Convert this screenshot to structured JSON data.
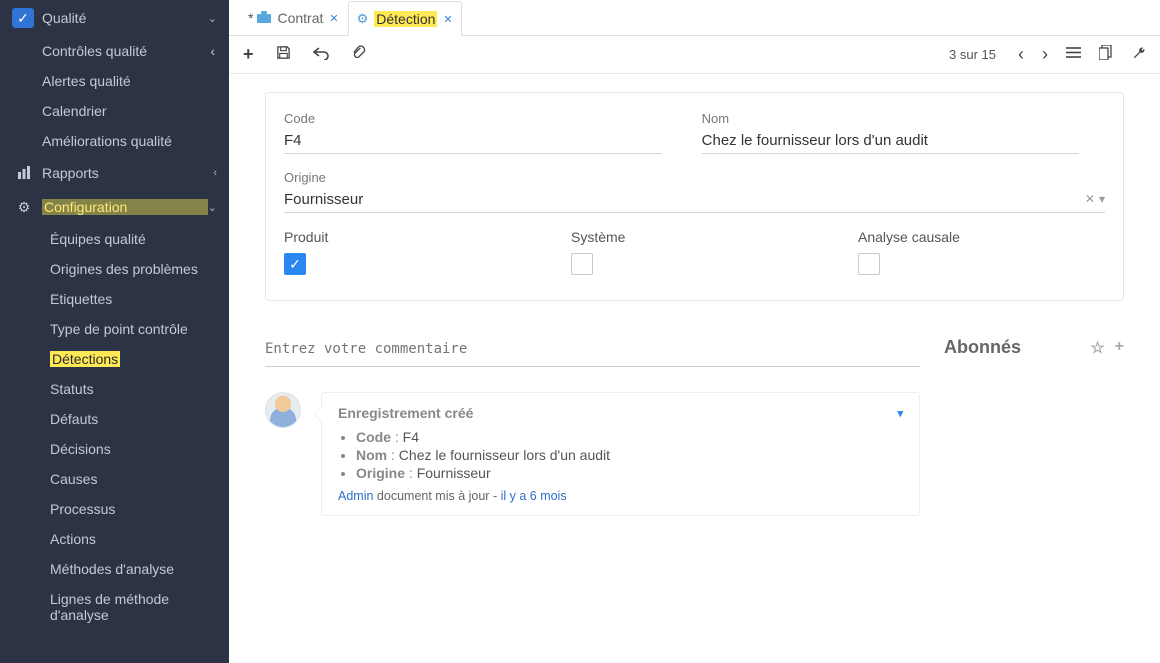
{
  "sidebar": {
    "top": {
      "label": "Qualité",
      "expanded": true,
      "items": [
        {
          "label": "Contrôles qualité",
          "has_sub": true
        },
        {
          "label": "Alertes qualité"
        },
        {
          "label": "Calendrier"
        },
        {
          "label": "Améliorations qualité"
        }
      ]
    },
    "reports": {
      "label": "Rapports",
      "has_sub": true
    },
    "config": {
      "label": "Configuration",
      "expanded": true,
      "highlight": true,
      "items": [
        {
          "label": "Équipes qualité"
        },
        {
          "label": "Origines des problèmes"
        },
        {
          "label": "Etiquettes"
        },
        {
          "label": "Type de point contrôle"
        },
        {
          "label": "Détections",
          "active": true,
          "highlight": true
        },
        {
          "label": "Statuts"
        },
        {
          "label": "Défauts"
        },
        {
          "label": "Décisions"
        },
        {
          "label": "Causes"
        },
        {
          "label": "Processus"
        },
        {
          "label": "Actions"
        },
        {
          "label": "Méthodes d'analyse"
        },
        {
          "label": "Lignes de méthode d'analyse"
        }
      ]
    }
  },
  "tabs": [
    {
      "icon": "briefcase",
      "label": "Contrat",
      "dirty": true,
      "active": false
    },
    {
      "icon": "gear",
      "label": "Détection",
      "dirty": false,
      "active": true,
      "highlight": true
    }
  ],
  "toolbar": {
    "counter": "3 sur 15"
  },
  "form": {
    "code": {
      "label": "Code",
      "value": "F4"
    },
    "name": {
      "label": "Nom",
      "value": "Chez le fournisseur lors d'un audit"
    },
    "origin": {
      "label": "Origine",
      "value": "Fournisseur"
    },
    "produit": {
      "label": "Produit",
      "checked": true
    },
    "systeme": {
      "label": "Système",
      "checked": false
    },
    "analyse": {
      "label": "Analyse causale",
      "checked": false
    }
  },
  "messages": {
    "comment_placeholder": "Entrez votre commentaire",
    "followers_title": "Abonnés",
    "record_created": {
      "title": "Enregistrement créé",
      "fields": [
        {
          "k": "Code",
          "v": "F4"
        },
        {
          "k": "Nom",
          "v": "Chez le fournisseur lors d'un audit"
        },
        {
          "k": "Origine",
          "v": "Fournisseur"
        }
      ],
      "footer": {
        "user": "Admin",
        "action": "document mis à jour",
        "time": "il y a 6 mois"
      }
    }
  }
}
